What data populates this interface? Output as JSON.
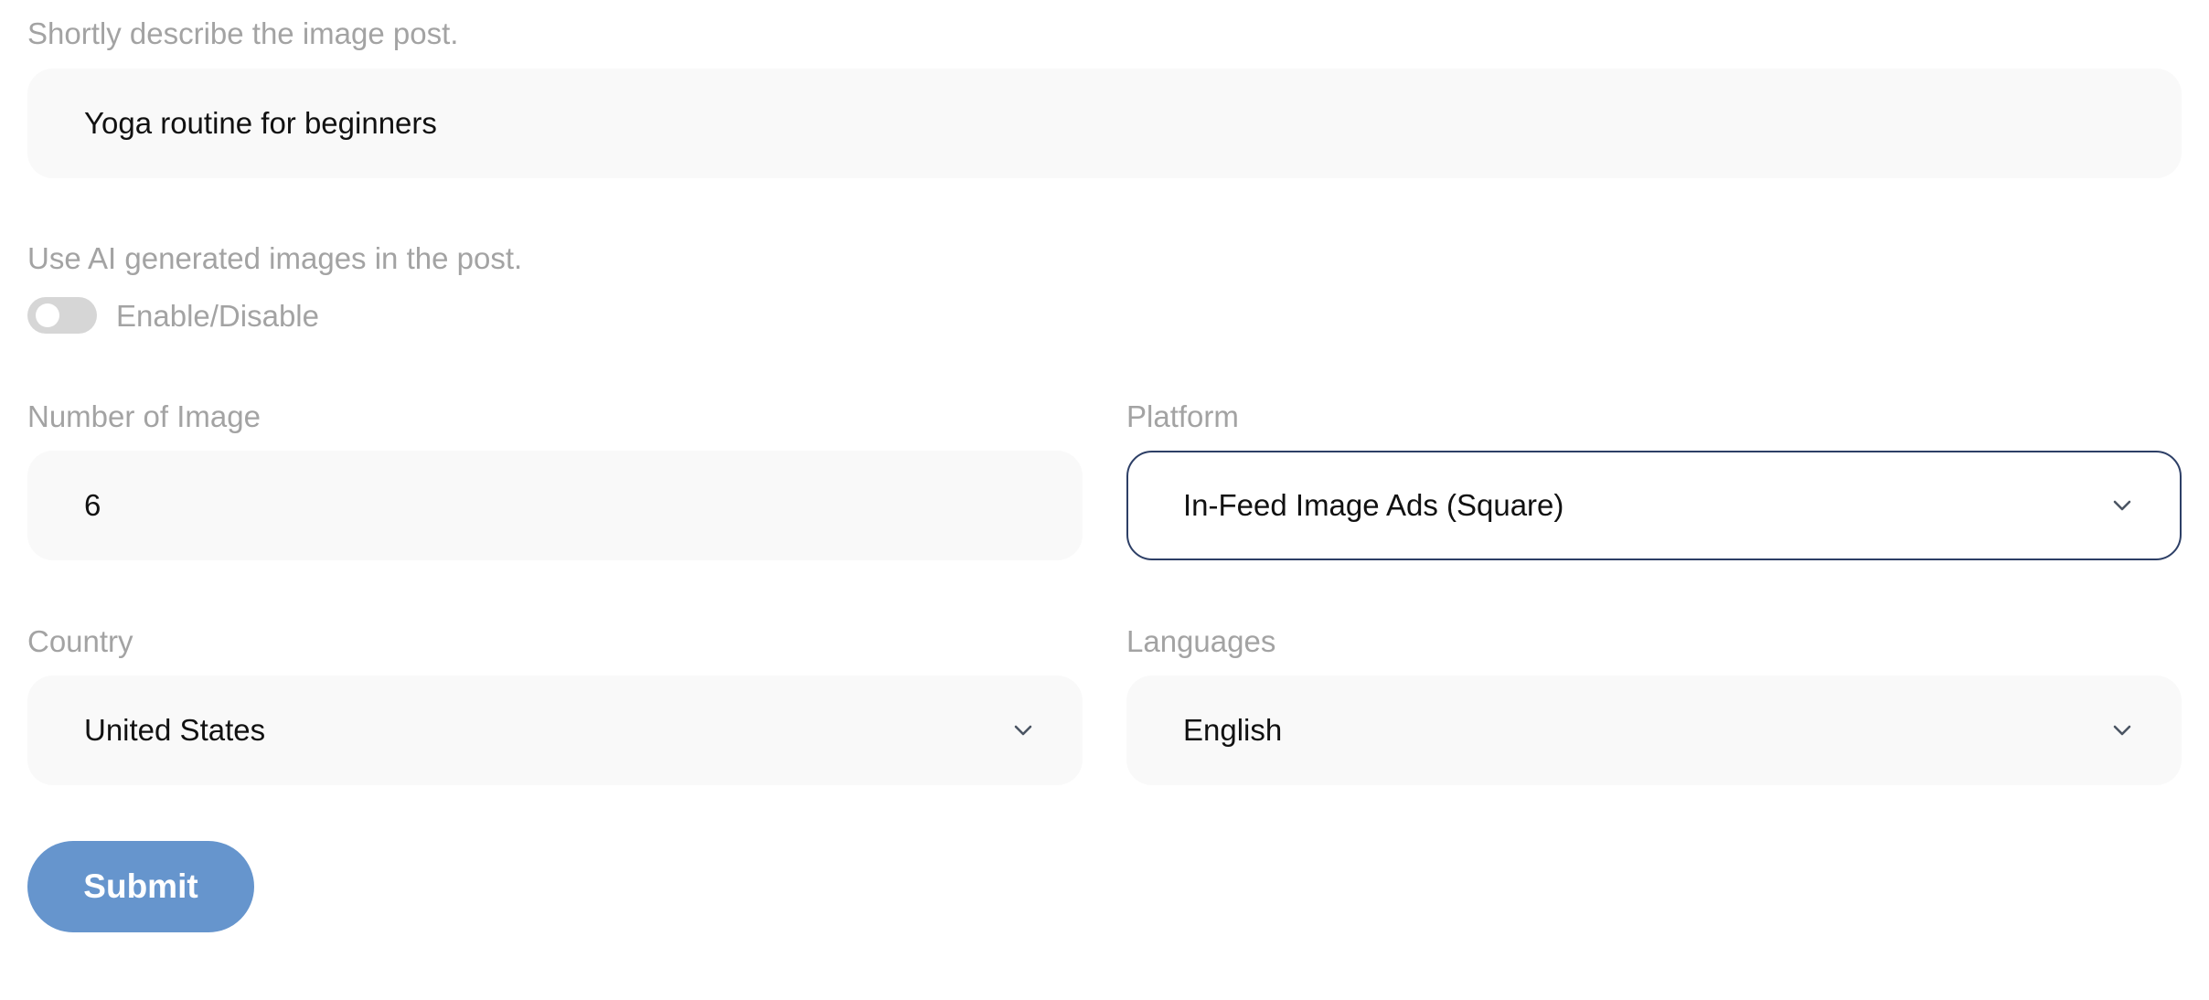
{
  "description": {
    "label": "Shortly describe the image post.",
    "value": "Yoga routine for beginners"
  },
  "ai_images": {
    "label": "Use AI generated images in the post.",
    "toggle_label": "Enable/Disable",
    "enabled": false
  },
  "number_of_images": {
    "label": "Number of Image",
    "value": "6"
  },
  "platform": {
    "label": "Platform",
    "value": "In-Feed Image Ads (Square)",
    "focused_border_color": "#2d3f66"
  },
  "country": {
    "label": "Country",
    "value": "United States"
  },
  "languages": {
    "label": "Languages",
    "value": "English"
  },
  "submit": {
    "label": "Submit",
    "color": "#6695cd"
  }
}
